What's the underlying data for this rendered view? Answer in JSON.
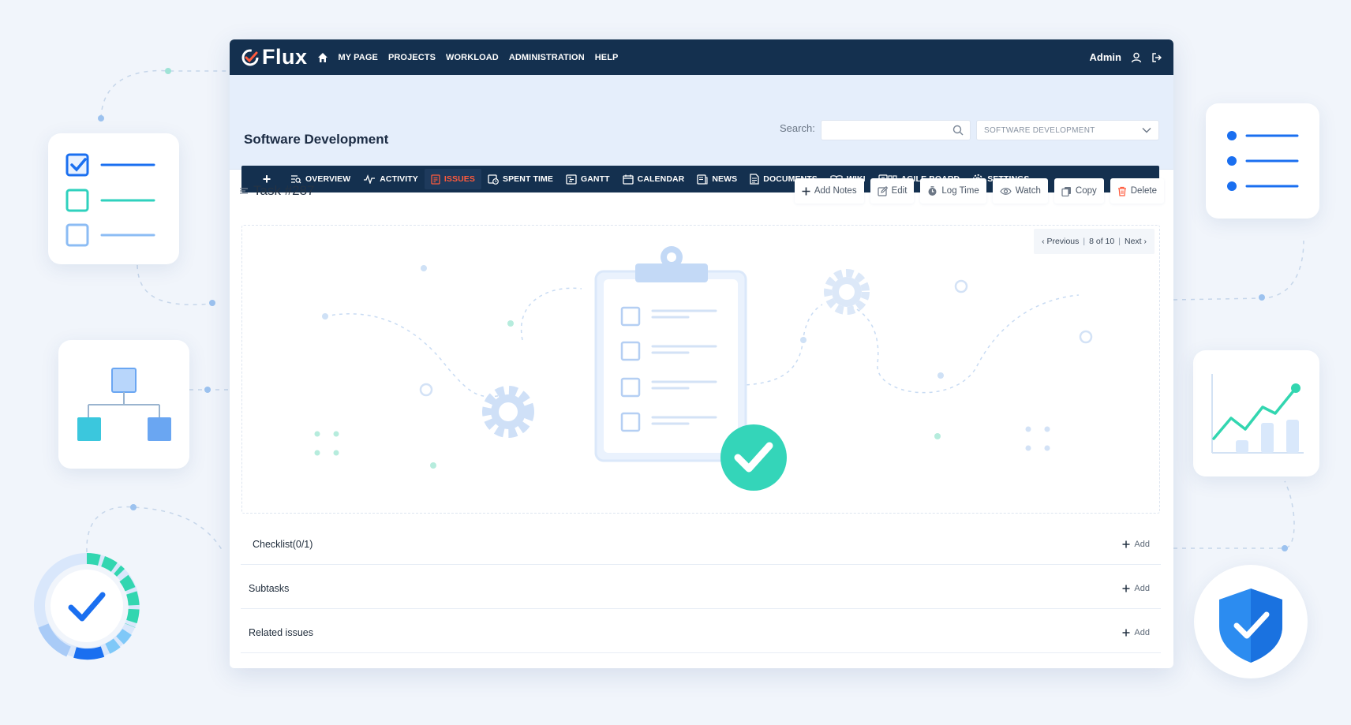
{
  "app": {
    "logo_text": "Flux",
    "brand_color": "#14304f",
    "accent_color": "#ff5a3c"
  },
  "topnav": {
    "items": [
      "MY PAGE",
      "PROJECTS",
      "WORKLOAD",
      "ADMINISTRATION",
      "HELP"
    ],
    "user": "Admin"
  },
  "project": {
    "title": "Software Development",
    "search_label": "Search:",
    "search_value": "",
    "selected_project": "SOFTWARE DEVELOPMENT"
  },
  "tabs": {
    "add_label": "+",
    "items": [
      {
        "label": "OVERVIEW",
        "icon": "overview-icon",
        "active": false
      },
      {
        "label": "ACTIVITY",
        "icon": "activity-icon",
        "active": false
      },
      {
        "label": "ISSUES",
        "icon": "issues-icon",
        "active": true
      },
      {
        "label": "SPENT TIME",
        "icon": "spent-time-icon",
        "active": false
      },
      {
        "label": "GANTT",
        "icon": "gantt-icon",
        "active": false
      },
      {
        "label": "CALENDAR",
        "icon": "calendar-icon",
        "active": false
      },
      {
        "label": "NEWS",
        "icon": "news-icon",
        "active": false
      },
      {
        "label": "DOCUMENTS",
        "icon": "documents-icon",
        "active": false
      },
      {
        "label": "WIKI",
        "icon": "wiki-icon",
        "active": false
      },
      {
        "label": "AGILE BOARD",
        "icon": "agile-board-icon",
        "active": false
      },
      {
        "label": "SETTINGS",
        "icon": "settings-icon",
        "active": false
      }
    ]
  },
  "task": {
    "title": "Task #287",
    "actions": [
      {
        "label": "Add Notes",
        "icon": "plus-icon"
      },
      {
        "label": "Edit",
        "icon": "edit-icon"
      },
      {
        "label": "Log Time",
        "icon": "clock-icon"
      },
      {
        "label": "Watch",
        "icon": "eye-icon"
      },
      {
        "label": "Copy",
        "icon": "copy-icon"
      },
      {
        "label": "Delete",
        "icon": "trash-icon"
      }
    ],
    "pager": {
      "previous": "Previous",
      "position": "8 of 10",
      "next": "Next"
    }
  },
  "sections": [
    {
      "title": "Checklist(0/1)",
      "add_label": "Add"
    },
    {
      "title": "Subtasks",
      "add_label": "Add"
    },
    {
      "title": "Related issues",
      "add_label": "Add"
    }
  ]
}
